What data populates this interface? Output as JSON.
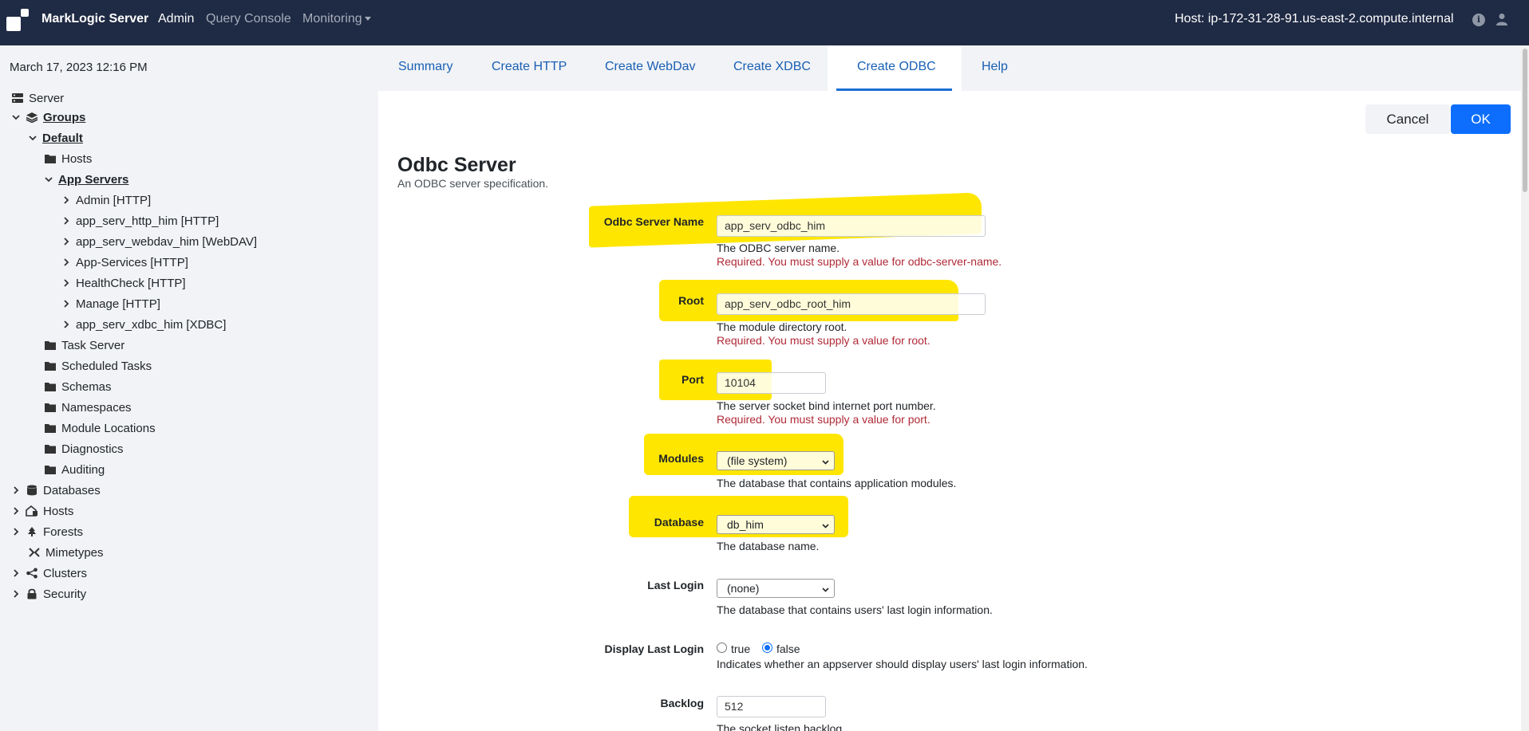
{
  "topbar": {
    "brand": "MarkLogic Server",
    "nav": [
      "Admin",
      "Query Console",
      "Monitoring"
    ],
    "host": "Host: ip-172-31-28-91.us-east-2.compute.internal",
    "info_icon": "info-icon",
    "user_icon": "user-icon"
  },
  "sidebar": {
    "datetime": "March 17, 2023 12:16 PM",
    "tree": [
      {
        "label": "Server",
        "icon": "server-icon"
      },
      {
        "label": "Groups",
        "icon": "layers-icon"
      },
      {
        "label": "Default"
      },
      {
        "label": "Hosts",
        "icon": "folder-icon"
      },
      {
        "label": "App Servers"
      },
      {
        "label": "Admin [HTTP]"
      },
      {
        "label": "app_serv_http_him [HTTP]"
      },
      {
        "label": "app_serv_webdav_him [WebDAV]"
      },
      {
        "label": "App-Services [HTTP]"
      },
      {
        "label": "HealthCheck [HTTP]"
      },
      {
        "label": "Manage [HTTP]"
      },
      {
        "label": "app_serv_xdbc_him [XDBC]"
      },
      {
        "label": "Task Server",
        "icon": "folder-icon"
      },
      {
        "label": "Scheduled Tasks",
        "icon": "folder-icon"
      },
      {
        "label": "Schemas",
        "icon": "folder-icon"
      },
      {
        "label": "Namespaces",
        "icon": "folder-icon"
      },
      {
        "label": "Module Locations",
        "icon": "folder-icon"
      },
      {
        "label": "Diagnostics",
        "icon": "folder-icon"
      },
      {
        "label": "Auditing",
        "icon": "folder-icon"
      },
      {
        "label": "Databases",
        "icon": "database-icon"
      },
      {
        "label": "Hosts",
        "icon": "hosts-icon"
      },
      {
        "label": "Forests",
        "icon": "tree-icon"
      },
      {
        "label": "Mimetypes",
        "icon": "mimetypes-icon"
      },
      {
        "label": "Clusters",
        "icon": "share-icon"
      },
      {
        "label": "Security",
        "icon": "lock-icon"
      }
    ]
  },
  "tabs": [
    "Summary",
    "Create HTTP",
    "Create WebDav",
    "Create XDBC",
    "Create ODBC",
    "Help"
  ],
  "actions": {
    "cancel": "Cancel",
    "ok": "OK"
  },
  "page": {
    "title": "Odbc Server",
    "subtitle": "An ODBC server specification."
  },
  "form": {
    "server_name": {
      "label": "Odbc Server Name",
      "value": "app_serv_odbc_him",
      "help": "The ODBC server name.",
      "error": "Required. You must supply a value for odbc-server-name."
    },
    "root": {
      "label": "Root",
      "value": "app_serv_odbc_root_him",
      "help": "The module directory root.",
      "error": "Required. You must supply a value for root."
    },
    "port": {
      "label": "Port",
      "value": "10104",
      "help": "The server socket bind internet port number.",
      "error": "Required. You must supply a value for port."
    },
    "modules": {
      "label": "Modules",
      "value": "(file system)",
      "help": "The database that contains application modules."
    },
    "database": {
      "label": "Database",
      "value": "db_him",
      "help": "The database name."
    },
    "last_login": {
      "label": "Last Login",
      "value": "(none)",
      "help": "The database that contains users' last login information."
    },
    "display_last_login": {
      "label": "Display Last Login",
      "opt_true": "true",
      "opt_false": "false",
      "selected": "false",
      "help": "Indicates whether an appserver should display users' last login information."
    },
    "backlog": {
      "label": "Backlog",
      "value": "512",
      "help": "The socket listen backlog."
    }
  },
  "colors": {
    "topbar": "#1f2a44",
    "accent": "#0d6efd",
    "highlight": "#ffe600",
    "error": "#b02a37"
  }
}
